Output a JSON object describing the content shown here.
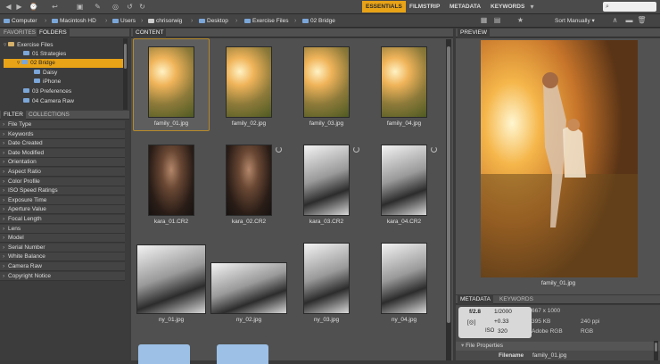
{
  "workspaces": {
    "essentials": "ESSENTIALS",
    "filmstrip": "FILMSTRIP",
    "metadata": "METADATA",
    "keywords": "KEYWORDS"
  },
  "sort_label": "Sort Manually",
  "search_placeholder": "",
  "breadcrumb": [
    "Computer",
    "Macintosh HD",
    "Users",
    "chrisorwig",
    "Desktop",
    "Exercise Files",
    "02 Bridge"
  ],
  "panels": {
    "favorites": "FAVORITES",
    "folders": "FOLDERS",
    "filter": "FILTER",
    "collections": "COLLECTIONS",
    "content": "CONTENT",
    "preview": "PREVIEW",
    "metadata": "METADATA",
    "keywords": "KEYWORDS"
  },
  "folders": [
    {
      "label": "Exercise Files"
    },
    {
      "label": "01 Strategies"
    },
    {
      "label": "02 Bridge"
    },
    {
      "label": "Daisy"
    },
    {
      "label": "iPhone"
    },
    {
      "label": "03 Preferences"
    },
    {
      "label": "04 Camera Raw"
    }
  ],
  "filters": [
    "File Type",
    "Keywords",
    "Date Created",
    "Date Modified",
    "Orientation",
    "Aspect Ratio",
    "Color Profile",
    "ISO Speed Ratings",
    "Exposure Time",
    "Aperture Value",
    "Focal Length",
    "Lens",
    "Model",
    "Serial Number",
    "White Balance",
    "Camera Raw",
    "Copyright Notice"
  ],
  "thumbnails": [
    {
      "name": "family_01.jpg",
      "selected": true
    },
    {
      "name": "family_02.jpg"
    },
    {
      "name": "family_03.jpg"
    },
    {
      "name": "family_04.jpg"
    },
    {
      "name": "kara_01.CR2"
    },
    {
      "name": "kara_02.CR2"
    },
    {
      "name": "kara_03.CR2"
    },
    {
      "name": "kara_04.CR2"
    },
    {
      "name": "ny_01.jpg"
    },
    {
      "name": "ny_02.jpg"
    },
    {
      "name": "ny_03.jpg"
    },
    {
      "name": "ny_04.jpg"
    }
  ],
  "preview_caption": "family_01.jpg",
  "metadata": {
    "aperture": "f/2.8",
    "shutter": "1/2000",
    "ev": "+0.33",
    "iso": "320",
    "dimensions": "667 x 1000",
    "size": "395 KB",
    "ppi": "240 ppi",
    "profile": "Adobe RGB",
    "mode": "RGB",
    "section": "File Properties",
    "filename_label": "Filename",
    "filename_value": "family_01.jpg"
  },
  "colors": {
    "accent": "#e8a317",
    "folder": "#7ba6d8"
  }
}
